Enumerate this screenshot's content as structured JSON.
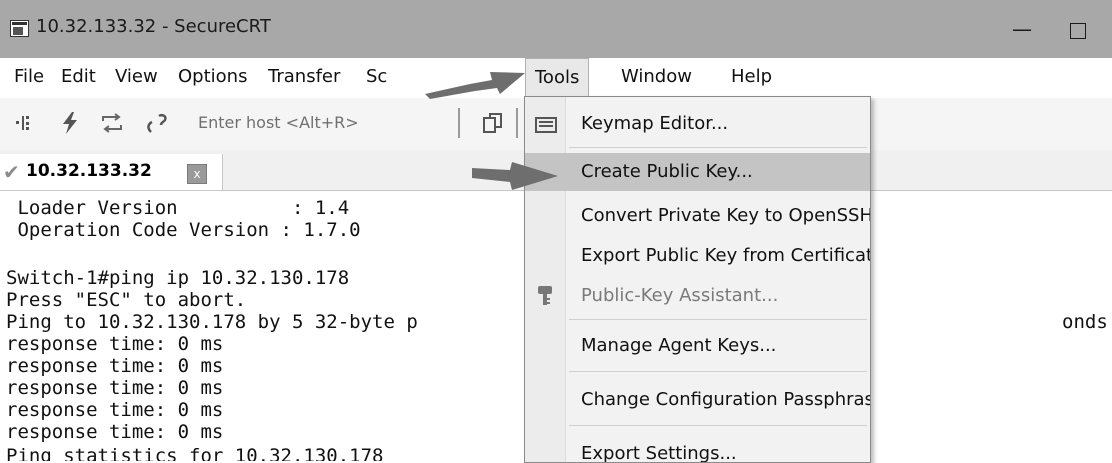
{
  "window": {
    "title": "10.32.133.32 - SecureCRT",
    "minimize_glyph": "—"
  },
  "menubar": {
    "items": [
      "File",
      "Edit",
      "View",
      "Options",
      "Transfer",
      "Script",
      "Tools",
      "Window",
      "Help"
    ],
    "partial_visible": "Sc",
    "active": "Tools"
  },
  "toolbar": {
    "host_placeholder": "Enter host <Alt+R>",
    "icons": [
      "quick-connect-icon",
      "lightning-icon",
      "reconnect-icon",
      "disconnect-icon",
      "copy-icon"
    ]
  },
  "session_tab": {
    "label": "10.32.133.32",
    "close_glyph": "x",
    "status_icon": "check-icon"
  },
  "terminal": {
    "lines": [
      " Loader Version          : 1.4",
      " Operation Code Version : 1.7.0",
      "",
      "Switch-1#ping ip 10.32.130.178",
      "Press \"ESC\" to abort.",
      "Ping to 10.32.130.178 by 5 32-byte p",
      "response time: 0 ms",
      "response time: 0 ms",
      "response time: 0 ms",
      "response time: 0 ms",
      "response time: 0 ms",
      "Ping statistics for 10.32.130.178"
    ],
    "right_fragment": "onds"
  },
  "tools_menu": {
    "items": [
      {
        "label": "Keymap Editor...",
        "icon": "keyboard-icon",
        "state": "normal"
      },
      {
        "label": "Create Public Key...",
        "icon": "",
        "state": "highlighted"
      },
      {
        "label": "Convert Private Key to OpenSSH Format...",
        "icon": "",
        "state": "normal"
      },
      {
        "label": "Export Public Key from Certificate...",
        "icon": "",
        "state": "normal"
      },
      {
        "label": "Public-Key Assistant...",
        "icon": "key-icon",
        "state": "disabled"
      },
      {
        "label": "Manage Agent Keys...",
        "icon": "",
        "state": "normal"
      },
      {
        "label": "Change Configuration Passphrase...",
        "icon": "",
        "state": "normal"
      },
      {
        "label": "Export Settings...",
        "icon": "",
        "state": "normal"
      }
    ]
  },
  "colors": {
    "titlebar": "#a8a8a8",
    "highlight": "#c4c4c4",
    "arrow": "#6e6e6e"
  }
}
